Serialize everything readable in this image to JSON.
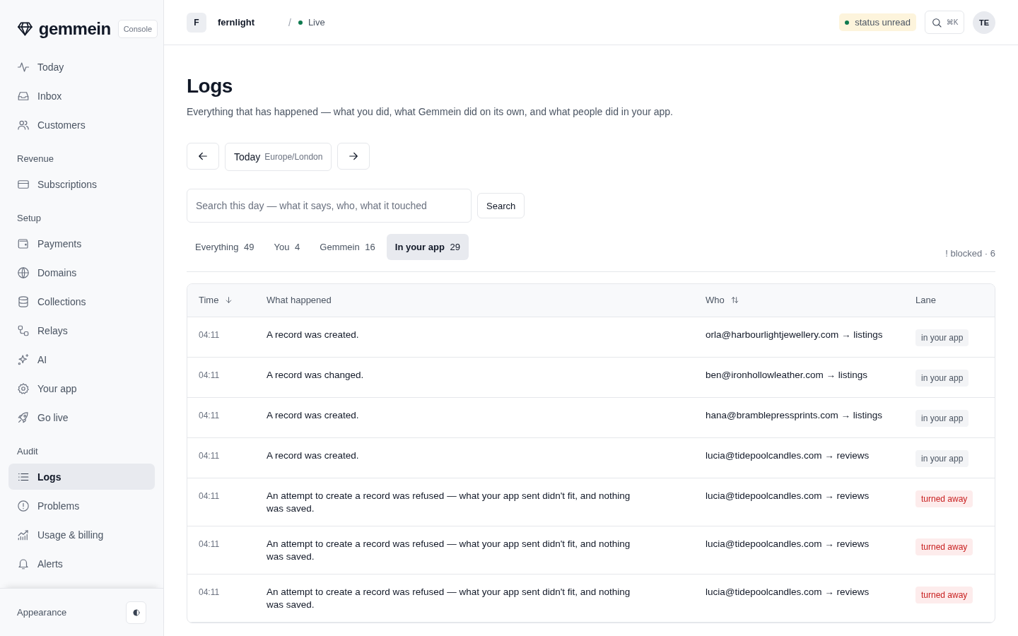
{
  "brand": {
    "name": "gemmein",
    "badge": "Console"
  },
  "topbar": {
    "workspace_initial": "F",
    "workspace": "fernlight",
    "separator": "/",
    "environment": "Live",
    "status": "status unread",
    "shortcut": "⌘K",
    "avatar": "TE"
  },
  "sidebar": {
    "sections": [
      {
        "items": [
          {
            "label": "Today",
            "selected": false
          },
          {
            "label": "Inbox",
            "selected": false
          },
          {
            "label": "Customers",
            "selected": false
          }
        ]
      },
      {
        "title": "Revenue",
        "items": [
          {
            "label": "Subscriptions",
            "selected": false
          }
        ]
      },
      {
        "title": "Setup",
        "items": [
          {
            "label": "Payments",
            "selected": false
          },
          {
            "label": "Domains",
            "selected": false
          },
          {
            "label": "Collections",
            "selected": false
          },
          {
            "label": "Relays",
            "selected": false
          },
          {
            "label": "AI",
            "selected": false
          },
          {
            "label": "Your app",
            "selected": false
          },
          {
            "label": "Go live",
            "selected": false
          }
        ]
      },
      {
        "title": "Audit",
        "items": [
          {
            "label": "Logs",
            "selected": true
          },
          {
            "label": "Problems",
            "selected": false
          },
          {
            "label": "Usage & billing",
            "selected": false
          },
          {
            "label": "Alerts",
            "selected": false
          }
        ]
      }
    ],
    "footer": "Appearance"
  },
  "page": {
    "title": "Logs",
    "subtitle": "Everything that has happened — what you did, what Gemmein did on its own, and what people did in your app.",
    "day": {
      "label": "Today",
      "timezone": "Europe/London"
    },
    "search": {
      "placeholder": "Search this day — what it says, who, what it touched",
      "button": "Search"
    },
    "filters": [
      {
        "label": "Everything",
        "count": "49",
        "selected": false
      },
      {
        "label": "You",
        "count": "4",
        "selected": false
      },
      {
        "label": "Gemmein",
        "count": "16",
        "selected": false
      },
      {
        "label": "In your app",
        "count": "29",
        "selected": true
      }
    ],
    "blocked": "! blocked · 6"
  },
  "table": {
    "columns": [
      {
        "label": "Time",
        "sortable": true,
        "sorted": true
      },
      {
        "label": "What happened",
        "sortable": false,
        "sorted": false
      },
      {
        "label": "Who",
        "sortable": true,
        "sorted": false
      },
      {
        "label": "Lane",
        "sortable": false,
        "sorted": false
      }
    ],
    "rows": [
      {
        "time": "04:11",
        "what": "A record was created.",
        "who": "orla@harbourlightjewellery.com → listings",
        "lane": "in your app",
        "kind": "ok"
      },
      {
        "time": "04:11",
        "what": "A record was changed.",
        "who": "ben@ironhollowleather.com → listings",
        "lane": "in your app",
        "kind": "ok"
      },
      {
        "time": "04:11",
        "what": "A record was created.",
        "who": "hana@bramblepressprints.com → listings",
        "lane": "in your app",
        "kind": "ok"
      },
      {
        "time": "04:11",
        "what": "A record was created.",
        "who": "lucia@tidepoolcandles.com → reviews",
        "lane": "in your app",
        "kind": "ok"
      },
      {
        "time": "04:11",
        "what": "An attempt to create a record was refused — what your app sent didn't fit, and nothing was saved.",
        "who": "lucia@tidepoolcandles.com → reviews",
        "lane": "turned away",
        "kind": "refused"
      },
      {
        "time": "04:11",
        "what": "An attempt to create a record was refused — what your app sent didn't fit, and nothing was saved.",
        "who": "lucia@tidepoolcandles.com → reviews",
        "lane": "turned away",
        "kind": "refused"
      },
      {
        "time": "04:11",
        "what": "An attempt to create a record was refused — what your app sent didn't fit, and nothing was saved.",
        "who": "lucia@tidepoolcandles.com → reviews",
        "lane": "turned away",
        "kind": "refused"
      }
    ]
  }
}
